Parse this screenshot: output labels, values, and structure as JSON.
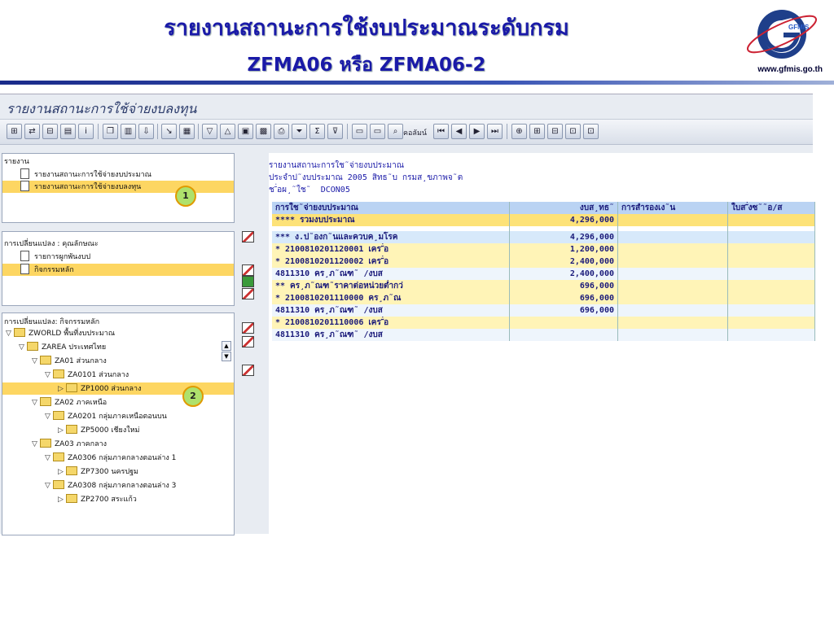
{
  "slide": {
    "title": "รายงานสถานะการใช้งบประมาณระดับกรม",
    "subtitle": "ZFMA06 หรือ ZFMA06-2",
    "logo_url": "www.gfmis.go.th",
    "logo_text": "GFMIS"
  },
  "window": {
    "title": "รายงานสถานะการใช้จ่ายงบลงทุน",
    "toolbar_label": "คอลัมน์"
  },
  "panel_reports": {
    "header": "รายงาน",
    "items": [
      "รายงานสถานะการใช้จ่ายงบประมาณ",
      "รายงานสถานะการใช้จ่ายงบลงทุน"
    ]
  },
  "panel_change": {
    "header": "การเปลี่ยนแปลง : คุณลักษณะ",
    "items": [
      "รายการผูกพันงบป",
      "กิจกรรมหลัก"
    ]
  },
  "panel_tree": {
    "header": "การเปลี่ยนแปลง: กิจกรรมหลัก",
    "nodes": [
      {
        "label": "ZWORLD พื้นที่งบประมาณ"
      },
      {
        "label": "ZAREA ประเทศไทย"
      },
      {
        "label": "ZA01 ส่วนกลาง"
      },
      {
        "label": "ZA0101 ส่วนกลาง"
      },
      {
        "label": "ZP1000 ส่วนกลาง"
      },
      {
        "label": "ZA02 ภาคเหนือ"
      },
      {
        "label": "ZA0201 กลุ่มภาคเหนือตอนบน"
      },
      {
        "label": "ZP5000 เชียงใหม่"
      },
      {
        "label": "ZA03 ภาคกลาง"
      },
      {
        "label": "ZA0306 กลุ่มภาคกลางตอนล่าง 1"
      },
      {
        "label": "ZP7300 นครปฐม"
      },
      {
        "label": "ZA0308 กลุ่มภาคกลางตอนล่าง 3"
      },
      {
        "label": "ZP2700 สระแก้ว"
      }
    ]
  },
  "badges": {
    "one": "1",
    "two": "2"
  },
  "report": {
    "line1": "รายงานสถานะการใช˜จ่ายงบประมาณ",
    "line2": "ประจำป˜งบประมาณ 2005 สิทธ˜บ กรมส¸ขภาพจ˜ต",
    "line3": "ช˜่อผ¸˜ใช˜  DCON05",
    "columns": [
      "การใช˜จ่ายงบประมาณ",
      "งบส¸ทธ˜",
      "การสำรองเง˜น",
      "ใบส˜่งซ˜˜อ/ส"
    ],
    "rows": [
      {
        "style": "r-total",
        "label": "**** รวมงบประมาณ",
        "amount": "4,296,000"
      },
      {
        "style": "r-sep",
        "label": "",
        "amount": ""
      },
      {
        "style": "r-blue",
        "label": "***    ง.ป˜องก˜นและควบค¸มโรค",
        "amount": "4,296,000"
      },
      {
        "style": "r-yellow",
        "label": "*         2100810201120001  เคร˜่อ",
        "amount": "1,200,000"
      },
      {
        "style": "r-yellow",
        "label": "*         2100810201120002  เคร˜่อ",
        "amount": "2,400,000"
      },
      {
        "style": "r-white",
        "label": "              4811310  คร¸ภ˜ณฑ˜ /งบส",
        "amount": "2,400,000"
      },
      {
        "style": "r-yellow",
        "label": "**    คร¸ภ˜ณฑ˜ราคาต่อหน่วยต่ำกว่",
        "amount": "696,000"
      },
      {
        "style": "r-yellow",
        "label": "*         2100810201110000  คร¸ภ˜ณ",
        "amount": "696,000"
      },
      {
        "style": "r-white",
        "label": "              4811310  คร¸ภ˜ณฑ˜ /งบส",
        "amount": "696,000"
      },
      {
        "style": "r-yellow",
        "label": "*         2100810201110006  เคร˜่อ",
        "amount": ""
      },
      {
        "style": "r-white",
        "label": "              4811310  คร¸ภ˜ณฑ˜ /งบส",
        "amount": ""
      }
    ]
  }
}
